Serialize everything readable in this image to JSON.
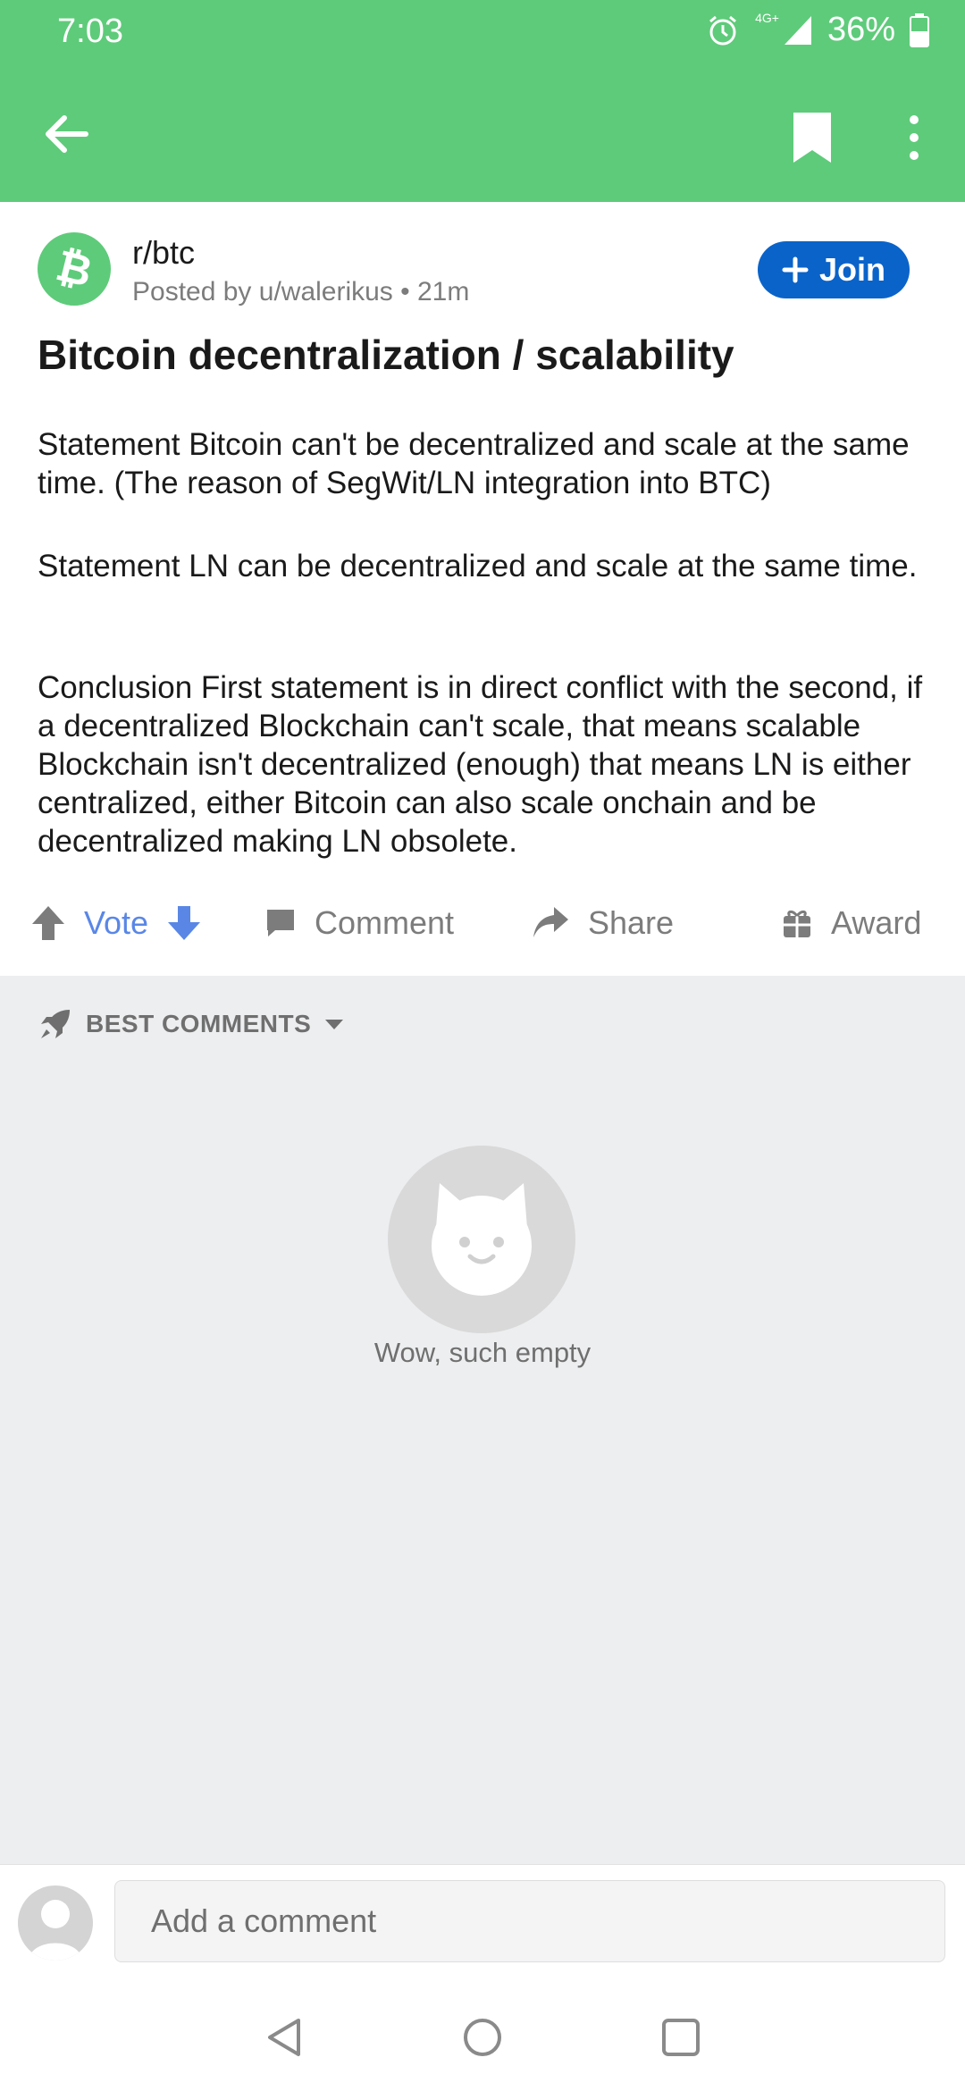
{
  "status": {
    "time": "7:03",
    "network": "4G+",
    "battery": "36%"
  },
  "post": {
    "subreddit": "r/btc",
    "posted_by": "Posted by u/walerikus • 21m",
    "join_label": "Join",
    "title": "Bitcoin decentralization / scalability",
    "paragraphs": [
      "Statement Bitcoin can't be decentralized and scale at the same time. (The reason of SegWit/LN integration into BTC)",
      "Statement LN can be decentralized and scale at the same time.",
      "Conclusion First statement is in direct conflict with the second, if a decentralized Blockchain can't scale, that means scalable Blockchain isn't decentralized (enough) that means LN is either centralized, either Bitcoin can also scale onchain and be decentralized making LN obsolete."
    ]
  },
  "actions": {
    "vote": "Vote",
    "comment": "Comment",
    "share": "Share",
    "award": "Award"
  },
  "comments": {
    "sort_label": "BEST COMMENTS",
    "empty_text": "Wow, such empty"
  },
  "composer": {
    "placeholder": "Add a comment"
  },
  "colors": {
    "app_bar": "#5ECB7A",
    "join": "#0A63C9",
    "vote": "#5a87e6"
  }
}
